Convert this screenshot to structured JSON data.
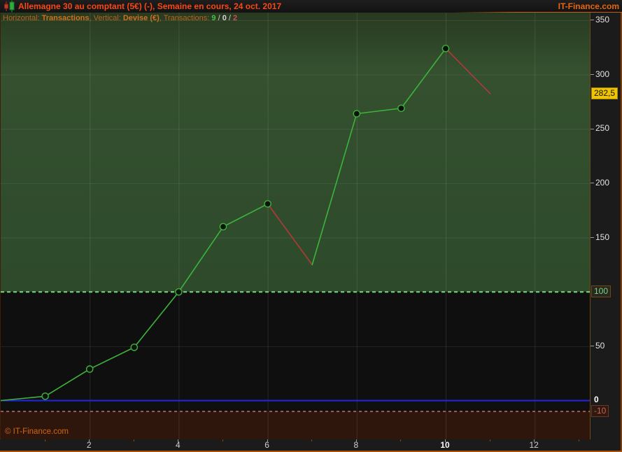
{
  "title_bar": {
    "title": "Allemagne 30 au comptant (5€) (-), Semaine en cours, 24 oct. 2017",
    "brand": "IT-Finance.com"
  },
  "info_line": {
    "horizontal_label": "Horizontal: ",
    "horizontal_value": "Transactions",
    "sep": ", ",
    "vertical_label": "Vertical: ",
    "vertical_value": "Devise (€)",
    "transactions_label": "Transactions: ",
    "wins": "9",
    "slash": " / ",
    "neutral": "0",
    "losses": "2"
  },
  "footer": {
    "copyright": "© IT-Finance.com"
  },
  "colors": {
    "title_accent": "#fb4713",
    "brand_orange": "#e8650f",
    "axis_bg": "#1b1b1b",
    "window_border": "#a9520e"
  },
  "chart_data": {
    "type": "line",
    "title": "Equity curve - Allemagne 30 au comptant, Semaine en cours",
    "xlabel": "Transactions",
    "ylabel": "Devise (€)",
    "ylim": [
      -36,
      357
    ],
    "xlim": [
      0,
      13.25
    ],
    "points": [
      {
        "t": 0,
        "v": 0,
        "marker": false
      },
      {
        "t": 1,
        "v": 4,
        "marker": true
      },
      {
        "t": 2,
        "v": 29,
        "marker": true
      },
      {
        "t": 3,
        "v": 49,
        "marker": true
      },
      {
        "t": 4,
        "v": 100,
        "marker": true
      },
      {
        "t": 5,
        "v": 160,
        "marker": true
      },
      {
        "t": 6,
        "v": 181,
        "marker": true
      },
      {
        "t": 7,
        "v": 125,
        "marker": false
      },
      {
        "t": 8,
        "v": 264,
        "marker": true
      },
      {
        "t": 9,
        "v": 269,
        "marker": true
      },
      {
        "t": 10,
        "v": 324,
        "marker": true
      },
      {
        "t": 11,
        "v": 282.5,
        "marker": false
      }
    ],
    "last_value_label": "282,5",
    "up_color": "#3cb43c",
    "down_color": "#b03a3a",
    "marker_fill": "#0c130c",
    "levels": [
      {
        "v": 100,
        "style": "dashed",
        "color": "#7fd77f",
        "badge": "100",
        "badge_class": "badge-win"
      },
      {
        "v": 0,
        "style": "solid",
        "color": "#2525e0",
        "label": "0"
      },
      {
        "v": -10,
        "style": "dashed",
        "color": "#a85454",
        "badge": "-10",
        "badge_class": "badge-loss"
      }
    ],
    "zones": {
      "win_above": 100,
      "loss_below": -10,
      "win_bg_top": "#283a20",
      "win_bg": "#34502f",
      "win_bg_bottom": "#2d4a2b",
      "neutral_bg": "#0f0f0f",
      "loss_bg": "#2e160d"
    },
    "grid": {
      "vertical": [
        2,
        4,
        6,
        8,
        10,
        12
      ],
      "horizontal": [
        350,
        300,
        250,
        200,
        150,
        50
      ]
    },
    "y_axis": {
      "ticks": [
        {
          "v": 350,
          "label": "350"
        },
        {
          "v": 300,
          "label": "300"
        },
        {
          "v": 250,
          "label": "250"
        },
        {
          "v": 200,
          "label": "200"
        },
        {
          "v": 150,
          "label": "150"
        },
        {
          "v": 50,
          "label": "50"
        }
      ]
    },
    "x_axis": {
      "labels": [
        {
          "v": 2,
          "label": "2",
          "bold": false
        },
        {
          "v": 4,
          "label": "4",
          "bold": false
        },
        {
          "v": 6,
          "label": "6",
          "bold": false
        },
        {
          "v": 8,
          "label": "8",
          "bold": false
        },
        {
          "v": 10,
          "label": "10",
          "bold": true
        },
        {
          "v": 12,
          "label": "12",
          "bold": false
        }
      ],
      "minor_ticks": [
        1,
        3,
        5,
        7,
        9,
        11,
        13
      ]
    }
  }
}
